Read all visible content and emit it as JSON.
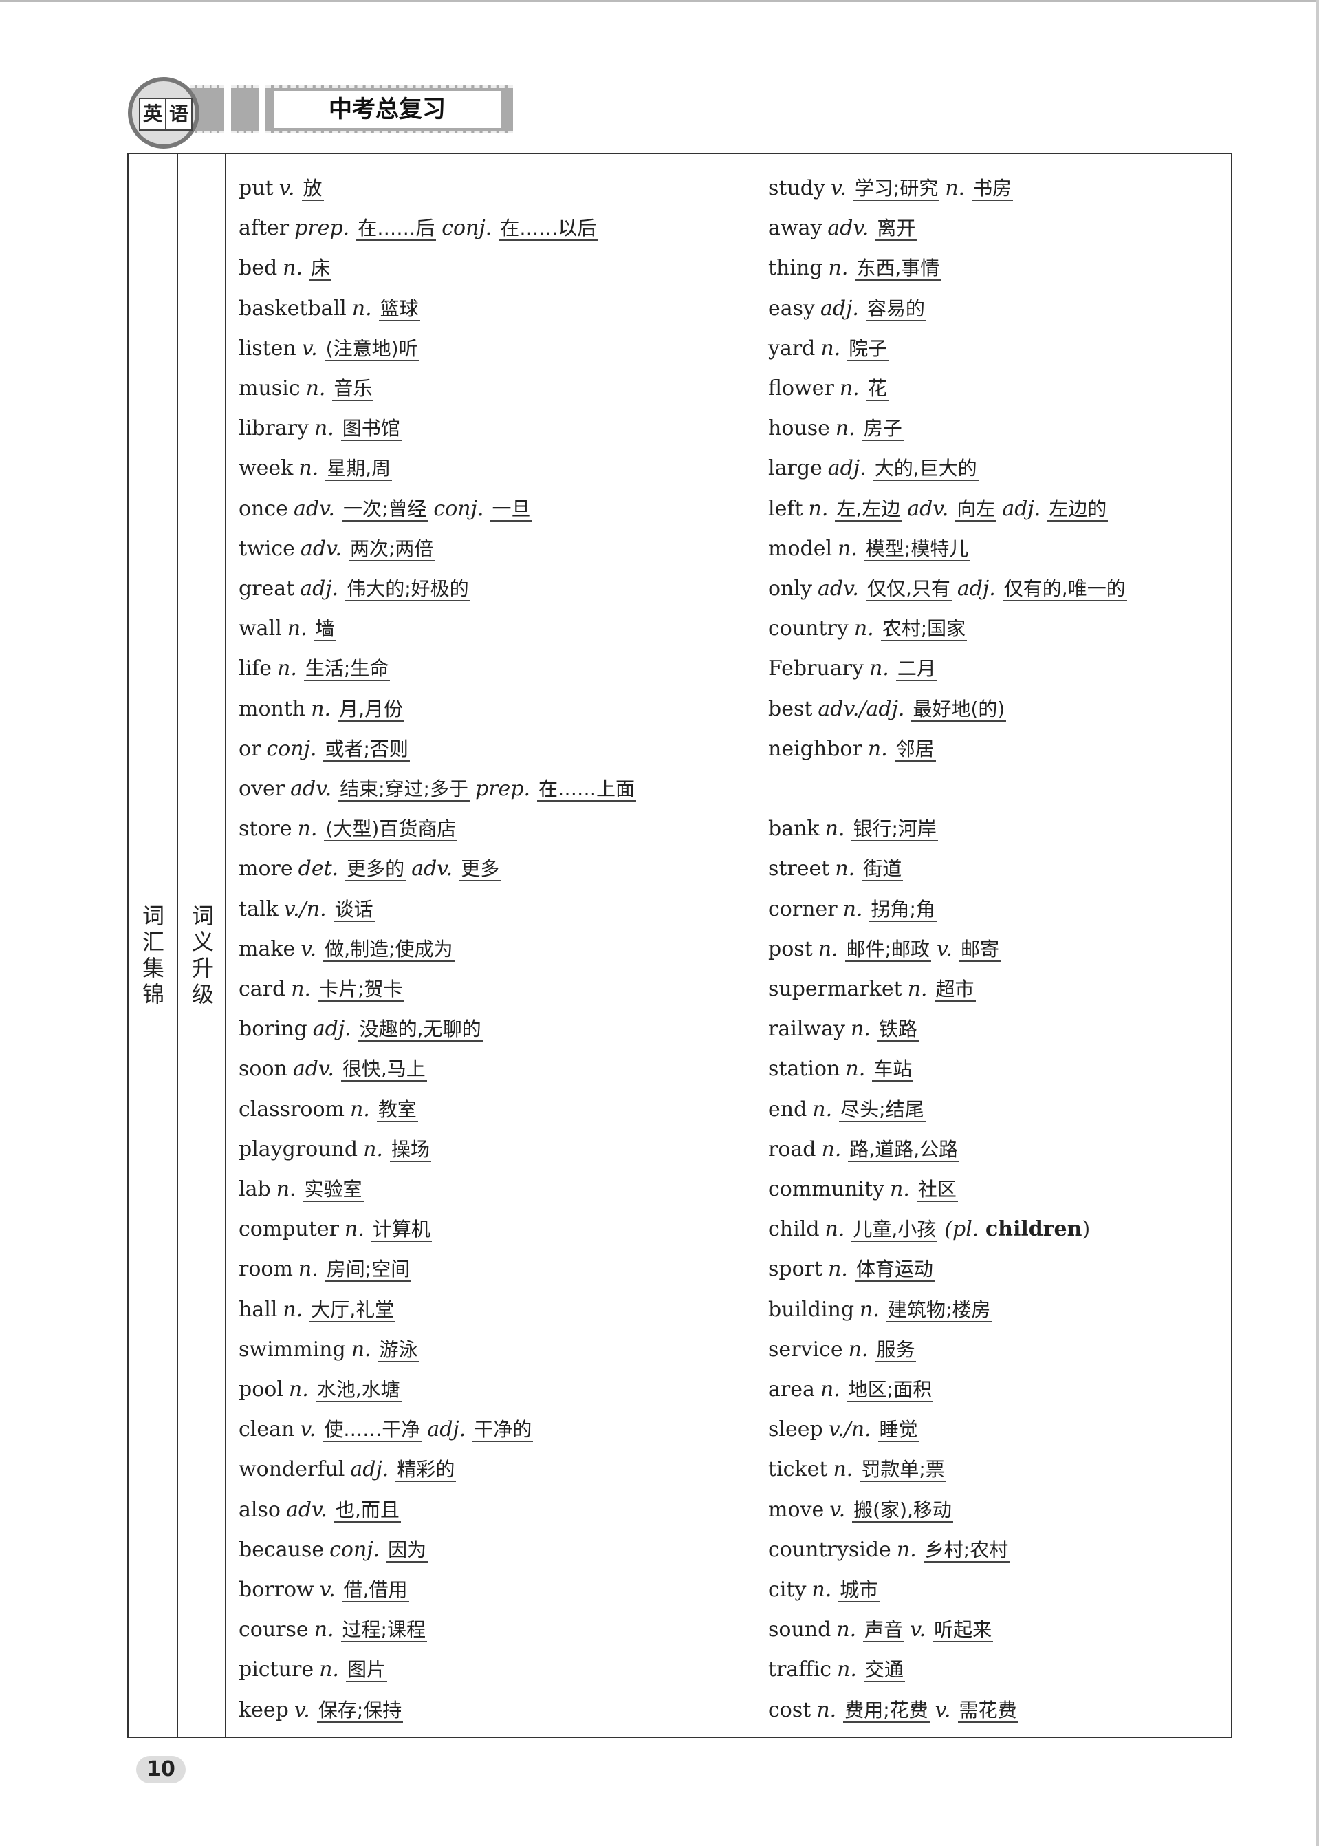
{
  "header": {
    "badge_chars": [
      "英",
      "语"
    ],
    "title": "中考总复习"
  },
  "section_label": "词汇集锦",
  "subsection_label": "词义升级",
  "page_number": "10",
  "left_entries": [
    {
      "word": "put",
      "parts": [
        {
          "pos": "v.",
          "meaning": "放"
        }
      ]
    },
    {
      "word": "after",
      "parts": [
        {
          "pos": "prep.",
          "meaning": "在……后"
        },
        {
          "pos": "conj.",
          "meaning": "在……以后"
        }
      ]
    },
    {
      "word": "bed",
      "parts": [
        {
          "pos": "n.",
          "meaning": "床"
        }
      ]
    },
    {
      "word": "basketball",
      "parts": [
        {
          "pos": "n.",
          "meaning": "篮球"
        }
      ]
    },
    {
      "word": "listen",
      "parts": [
        {
          "pos": "v.",
          "meaning": "(注意地)听"
        }
      ]
    },
    {
      "word": "music",
      "parts": [
        {
          "pos": "n.",
          "meaning": "音乐"
        }
      ]
    },
    {
      "word": "library",
      "parts": [
        {
          "pos": "n.",
          "meaning": "图书馆"
        }
      ]
    },
    {
      "word": "week",
      "parts": [
        {
          "pos": "n.",
          "meaning": "星期,周"
        }
      ]
    },
    {
      "word": "once",
      "parts": [
        {
          "pos": "adv.",
          "meaning": "一次;曾经"
        },
        {
          "pos": "conj.",
          "meaning": "一旦"
        }
      ]
    },
    {
      "word": "twice",
      "parts": [
        {
          "pos": "adv.",
          "meaning": "两次;两倍"
        }
      ]
    },
    {
      "word": "great",
      "parts": [
        {
          "pos": "adj.",
          "meaning": "伟大的;好极的"
        }
      ]
    },
    {
      "word": "wall",
      "parts": [
        {
          "pos": "n.",
          "meaning": "墙"
        }
      ]
    },
    {
      "word": "life",
      "parts": [
        {
          "pos": "n.",
          "meaning": "生活;生命"
        }
      ]
    },
    {
      "word": "month",
      "parts": [
        {
          "pos": "n.",
          "meaning": "月,月份"
        }
      ]
    },
    {
      "word": "or",
      "parts": [
        {
          "pos": "conj.",
          "meaning": "或者;否则"
        }
      ]
    },
    {
      "word": "over",
      "parts": [
        {
          "pos": "adv.",
          "meaning": "结束;穿过;多于"
        },
        {
          "pos": "prep.",
          "meaning": "在……上面"
        }
      ]
    },
    {
      "word": "store",
      "parts": [
        {
          "pos": "n.",
          "meaning": "(大型)百货商店"
        }
      ]
    },
    {
      "word": "more",
      "parts": [
        {
          "pos": "det.",
          "meaning": "更多的"
        },
        {
          "pos": "adv.",
          "meaning": "更多"
        }
      ]
    },
    {
      "word": "talk",
      "parts": [
        {
          "pos": "v./n.",
          "meaning": "谈话"
        }
      ]
    },
    {
      "word": "make",
      "parts": [
        {
          "pos": "v.",
          "meaning": "做,制造;使成为"
        }
      ]
    },
    {
      "word": "card",
      "parts": [
        {
          "pos": "n.",
          "meaning": "卡片;贺卡"
        }
      ]
    },
    {
      "word": "boring",
      "parts": [
        {
          "pos": "adj.",
          "meaning": "没趣的,无聊的"
        }
      ]
    },
    {
      "word": "soon",
      "parts": [
        {
          "pos": "adv.",
          "meaning": "很快,马上"
        }
      ]
    },
    {
      "word": "classroom",
      "parts": [
        {
          "pos": "n.",
          "meaning": "教室"
        }
      ]
    },
    {
      "word": "playground",
      "parts": [
        {
          "pos": "n.",
          "meaning": "操场"
        }
      ]
    },
    {
      "word": "lab",
      "parts": [
        {
          "pos": "n.",
          "meaning": "实验室"
        }
      ]
    },
    {
      "word": "computer",
      "parts": [
        {
          "pos": "n.",
          "meaning": "计算机"
        }
      ]
    },
    {
      "word": "room",
      "parts": [
        {
          "pos": "n.",
          "meaning": "房间;空间"
        }
      ]
    },
    {
      "word": "hall",
      "parts": [
        {
          "pos": "n.",
          "meaning": "大厅,礼堂"
        }
      ]
    },
    {
      "word": "swimming",
      "parts": [
        {
          "pos": "n.",
          "meaning": "游泳"
        }
      ]
    },
    {
      "word": "pool",
      "parts": [
        {
          "pos": "n.",
          "meaning": "水池,水塘"
        }
      ]
    },
    {
      "word": "clean",
      "parts": [
        {
          "pos": "v.",
          "meaning": "使……干净"
        },
        {
          "pos": "adj.",
          "meaning": "干净的"
        }
      ]
    },
    {
      "word": "wonderful",
      "parts": [
        {
          "pos": "adj.",
          "meaning": "精彩的"
        }
      ]
    },
    {
      "word": "also",
      "parts": [
        {
          "pos": "adv.",
          "meaning": "也,而且"
        }
      ]
    },
    {
      "word": "because",
      "parts": [
        {
          "pos": "conj.",
          "meaning": "因为"
        }
      ]
    },
    {
      "word": "borrow",
      "parts": [
        {
          "pos": "v.",
          "meaning": "借,借用"
        }
      ]
    },
    {
      "word": "course",
      "parts": [
        {
          "pos": "n.",
          "meaning": "过程;课程"
        }
      ]
    },
    {
      "word": "picture",
      "parts": [
        {
          "pos": "n.",
          "meaning": "图片"
        }
      ]
    },
    {
      "word": "keep",
      "parts": [
        {
          "pos": "v.",
          "meaning": "保存;保持"
        }
      ]
    }
  ],
  "right_entries": [
    {
      "word": "study",
      "parts": [
        {
          "pos": "v.",
          "meaning": "学习;研究"
        },
        {
          "pos": "n.",
          "meaning": "书房"
        }
      ]
    },
    {
      "word": "away",
      "parts": [
        {
          "pos": "adv.",
          "meaning": "离开"
        }
      ]
    },
    {
      "word": "thing",
      "parts": [
        {
          "pos": "n.",
          "meaning": "东西,事情"
        }
      ]
    },
    {
      "word": "easy",
      "parts": [
        {
          "pos": "adj.",
          "meaning": "容易的"
        }
      ]
    },
    {
      "word": "yard",
      "parts": [
        {
          "pos": "n.",
          "meaning": "院子"
        }
      ]
    },
    {
      "word": "flower",
      "parts": [
        {
          "pos": "n.",
          "meaning": "花"
        }
      ]
    },
    {
      "word": "house",
      "parts": [
        {
          "pos": "n.",
          "meaning": "房子"
        }
      ]
    },
    {
      "word": "large",
      "parts": [
        {
          "pos": "adj.",
          "meaning": "大的,巨大的"
        }
      ]
    },
    {
      "word": "left",
      "parts": [
        {
          "pos": "n.",
          "meaning": "左,左边"
        },
        {
          "pos": "adv.",
          "meaning": "向左"
        },
        {
          "pos": "adj.",
          "meaning": "左边的"
        }
      ]
    },
    {
      "word": "model",
      "parts": [
        {
          "pos": "n.",
          "meaning": "模型;模特儿"
        }
      ]
    },
    {
      "word": "only",
      "parts": [
        {
          "pos": "adv.",
          "meaning": "仅仅,只有"
        },
        {
          "pos": "adj.",
          "meaning": "仅有的,唯一的"
        }
      ]
    },
    {
      "word": "country",
      "parts": [
        {
          "pos": "n.",
          "meaning": "农村;国家"
        }
      ]
    },
    {
      "word": "February",
      "parts": [
        {
          "pos": "n.",
          "meaning": "二月"
        }
      ]
    },
    {
      "word": "best",
      "parts": [
        {
          "pos": "adv./adj.",
          "meaning": "最好地(的)"
        }
      ]
    },
    {
      "word": "neighbor",
      "parts": [
        {
          "pos": "n.",
          "meaning": "邻居"
        }
      ]
    },
    null,
    {
      "word": "bank",
      "parts": [
        {
          "pos": "n.",
          "meaning": "银行;河岸"
        }
      ]
    },
    {
      "word": "street",
      "parts": [
        {
          "pos": "n.",
          "meaning": "街道"
        }
      ]
    },
    {
      "word": "corner",
      "parts": [
        {
          "pos": "n.",
          "meaning": "拐角;角"
        }
      ]
    },
    {
      "word": "post",
      "parts": [
        {
          "pos": "n.",
          "meaning": "邮件;邮政"
        },
        {
          "pos": "v.",
          "meaning": "邮寄"
        }
      ]
    },
    {
      "word": "supermarket",
      "parts": [
        {
          "pos": "n.",
          "meaning": "超市"
        }
      ]
    },
    {
      "word": "railway",
      "parts": [
        {
          "pos": "n.",
          "meaning": "铁路"
        }
      ]
    },
    {
      "word": "station",
      "parts": [
        {
          "pos": "n.",
          "meaning": "车站"
        }
      ]
    },
    {
      "word": "end",
      "parts": [
        {
          "pos": "n.",
          "meaning": "尽头;结尾"
        }
      ]
    },
    {
      "word": "road",
      "parts": [
        {
          "pos": "n.",
          "meaning": "路,道路,公路"
        }
      ]
    },
    {
      "word": "community",
      "parts": [
        {
          "pos": "n.",
          "meaning": "社区"
        }
      ]
    },
    {
      "word": "child",
      "parts": [
        {
          "pos": "n.",
          "meaning": "儿童,小孩"
        }
      ],
      "extra": {
        "pre": "(pl.",
        "bold": "children",
        "post": ")"
      }
    },
    {
      "word": "sport",
      "parts": [
        {
          "pos": "n.",
          "meaning": "体育运动"
        }
      ]
    },
    {
      "word": "building",
      "parts": [
        {
          "pos": "n.",
          "meaning": "建筑物;楼房"
        }
      ]
    },
    {
      "word": "service",
      "parts": [
        {
          "pos": "n.",
          "meaning": "服务"
        }
      ]
    },
    {
      "word": "area",
      "parts": [
        {
          "pos": "n.",
          "meaning": "地区;面积"
        }
      ]
    },
    {
      "word": "sleep",
      "parts": [
        {
          "pos": "v./n.",
          "meaning": "睡觉"
        }
      ]
    },
    {
      "word": "ticket",
      "parts": [
        {
          "pos": "n.",
          "meaning": "罚款单;票"
        }
      ]
    },
    {
      "word": "move",
      "parts": [
        {
          "pos": "v.",
          "meaning": "搬(家),移动"
        }
      ]
    },
    {
      "word": "countryside",
      "parts": [
        {
          "pos": "n.",
          "meaning": "乡村;农村"
        }
      ]
    },
    {
      "word": "city",
      "parts": [
        {
          "pos": "n.",
          "meaning": "城市"
        }
      ]
    },
    {
      "word": "sound",
      "parts": [
        {
          "pos": "n.",
          "meaning": "声音"
        },
        {
          "pos": "v.",
          "meaning": "听起来"
        }
      ]
    },
    {
      "word": "traffic",
      "parts": [
        {
          "pos": "n.",
          "meaning": "交通"
        }
      ]
    },
    {
      "word": "cost",
      "parts": [
        {
          "pos": "n.",
          "meaning": "费用;花费"
        },
        {
          "pos": "v.",
          "meaning": "需花费"
        }
      ]
    }
  ]
}
